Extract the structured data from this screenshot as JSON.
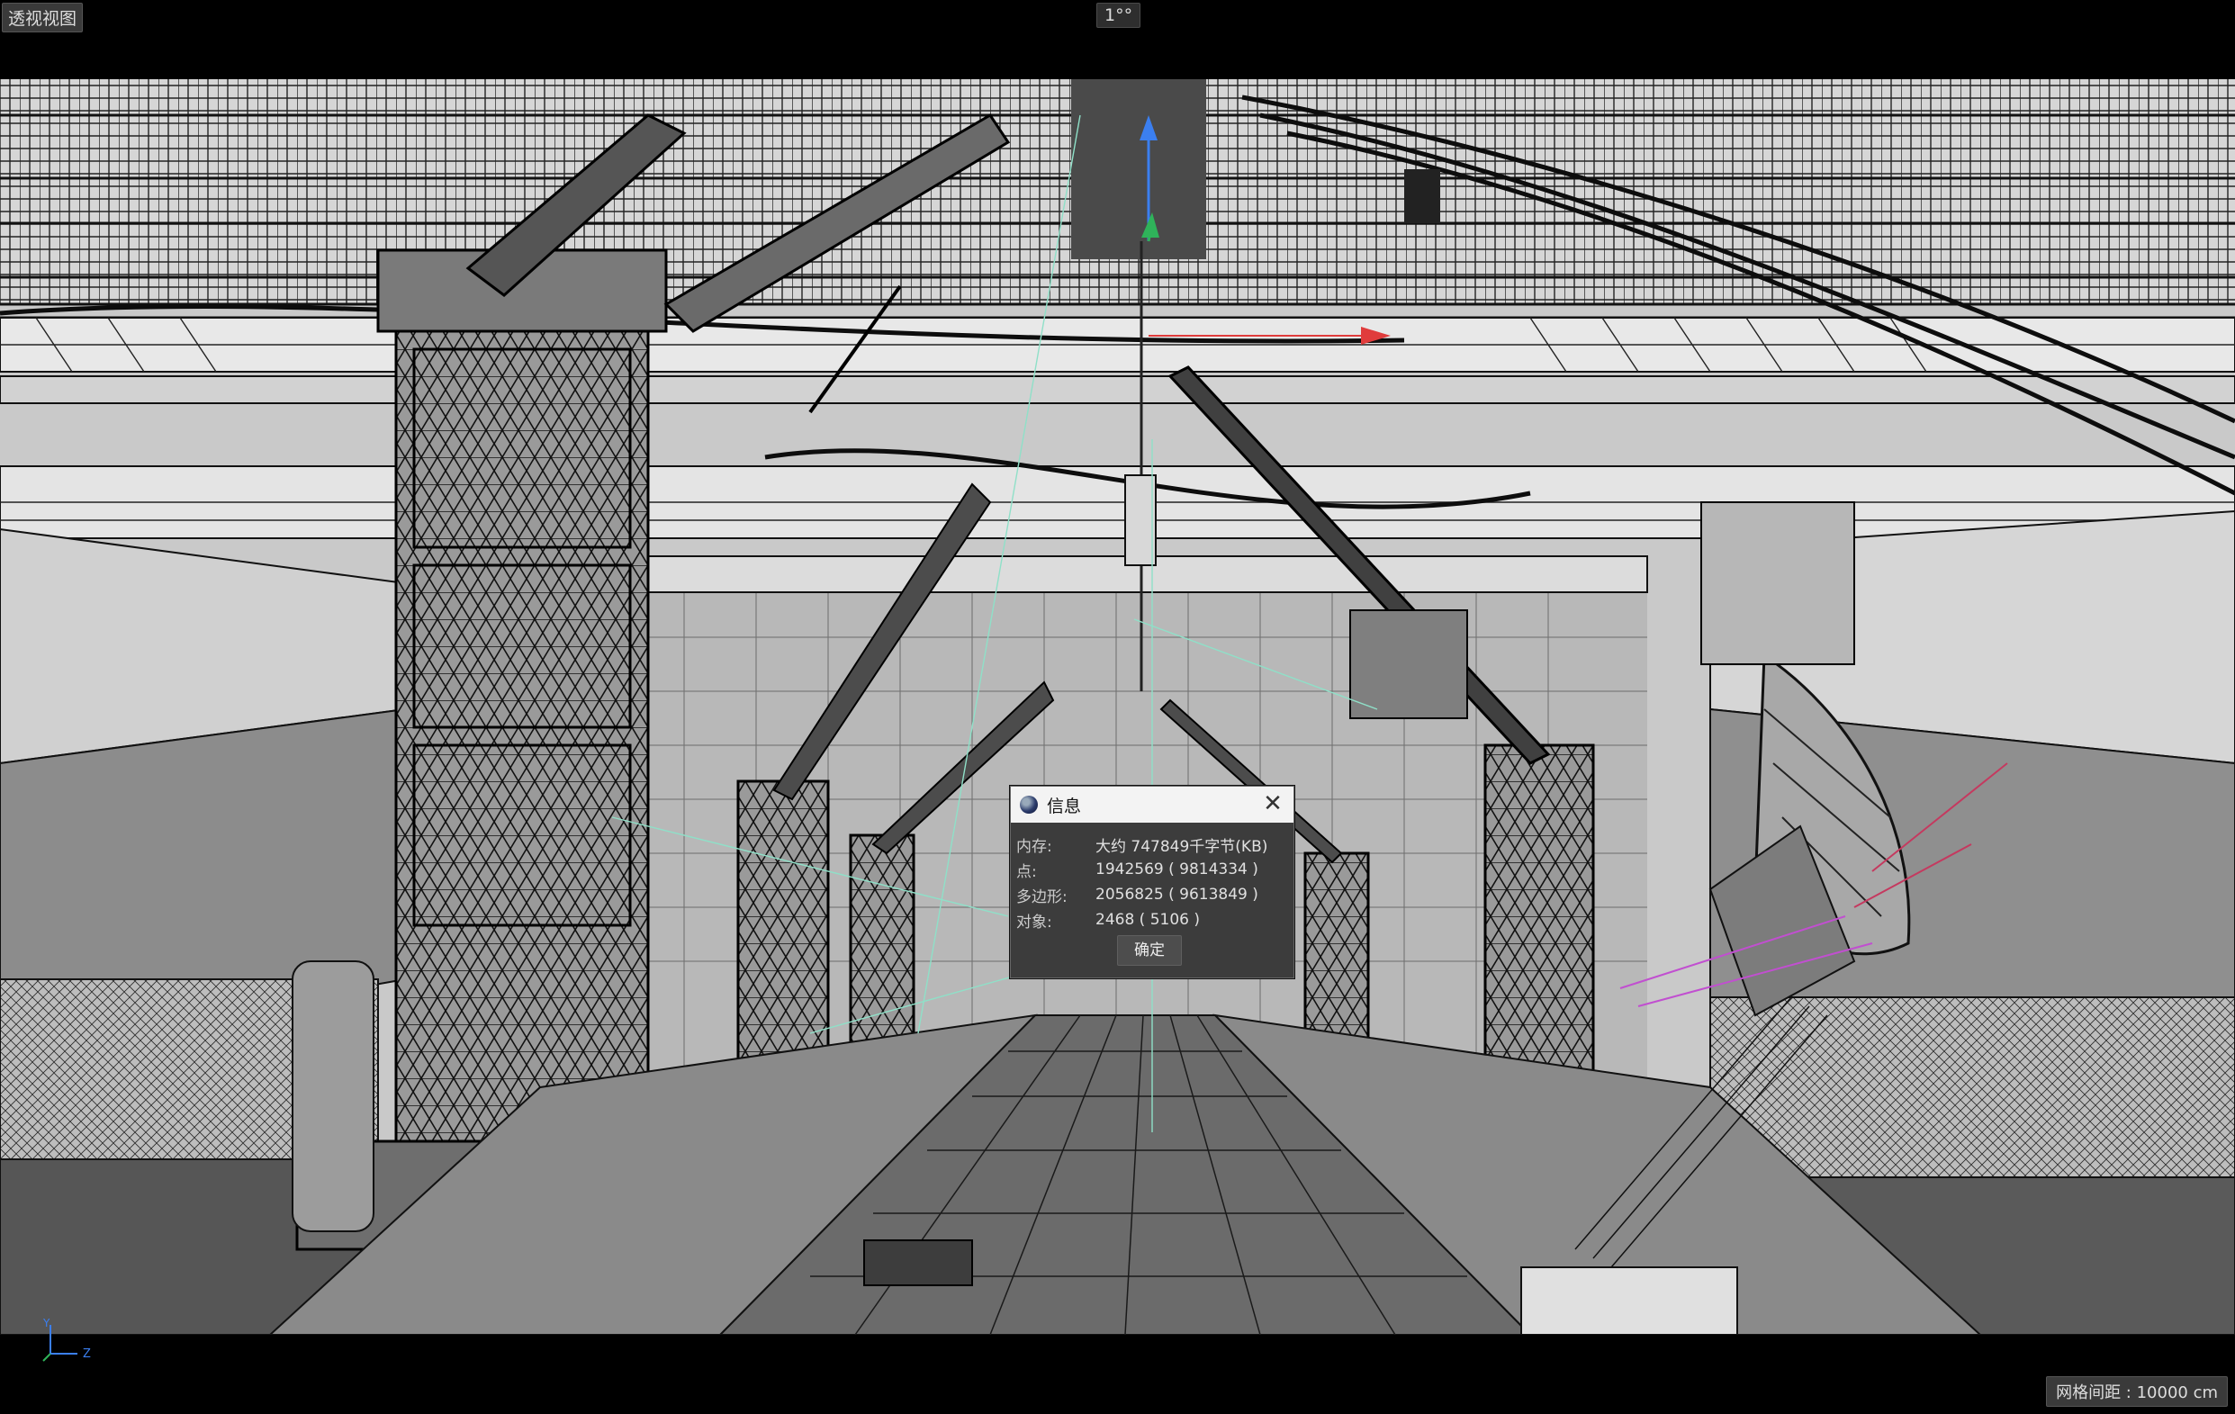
{
  "viewport": {
    "label": "透视视图",
    "camera_indicator": "1°°",
    "grid_spacing": "网格间距 : 10000 cm"
  },
  "axis": {
    "y_label": "Y",
    "z_label": "Z"
  },
  "dialog": {
    "title": "信息",
    "close_symbol": "✕",
    "rows": [
      {
        "label": "内存:",
        "value": "大约 747849千字节(KB)"
      },
      {
        "label": "点:",
        "value": "1942569 ( 9814334 )"
      },
      {
        "label": "多边形:",
        "value": "2056825 ( 9613849 )"
      },
      {
        "label": "对象:",
        "value": "2468 ( 5106 )"
      }
    ],
    "ok_label": "确定"
  },
  "colors": {
    "background": "#000000",
    "viewport": "#c9c9c9",
    "wire": "#1a1a1a",
    "gizmo_y": "#3b7ff0",
    "gizmo_x": "#e03c3c",
    "gizmo_z": "#2fb35a"
  },
  "icons": [
    "cinema4d-logo-icon",
    "close-icon",
    "axis-gizmo-icon"
  ]
}
